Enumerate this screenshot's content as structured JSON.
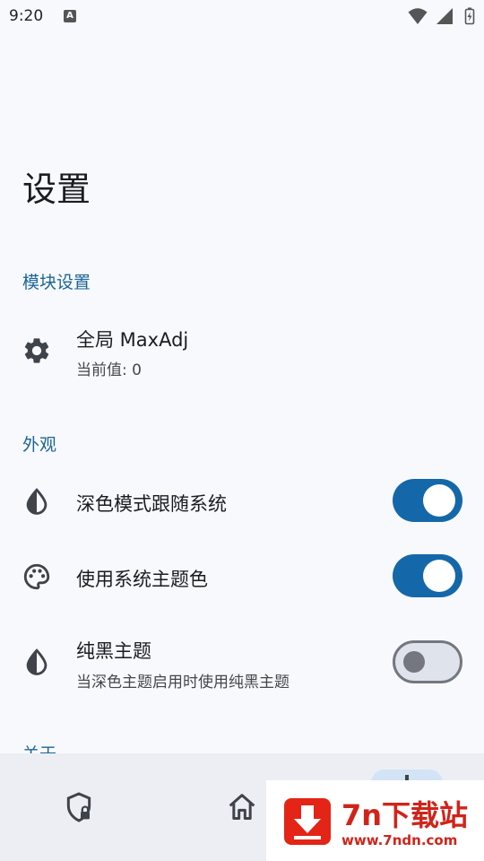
{
  "status_bar": {
    "time": "9:20",
    "notification_icon": "A"
  },
  "page_title": "设置",
  "sections": [
    {
      "header": "模块设置",
      "items": [
        {
          "icon": "gear-icon",
          "title": "全局 MaxAdj",
          "summary": "当前值: 0"
        }
      ]
    },
    {
      "header": "外观",
      "items": [
        {
          "icon": "contrast-drop-icon",
          "title": "深色模式跟随系统",
          "switch_on": true
        },
        {
          "icon": "palette-icon",
          "title": "使用系统主题色",
          "switch_on": true
        },
        {
          "icon": "contrast-drop-icon",
          "title": "纯黑主题",
          "summary": "当深色主题启用时使用纯黑主题",
          "switch_on": false
        }
      ]
    },
    {
      "header": "关于"
    }
  ],
  "bottom_nav": [
    {
      "icon": "shield-lock-icon"
    },
    {
      "icon": "home-icon"
    },
    {
      "icon": "settings-icon",
      "selected": true
    }
  ],
  "watermark": {
    "title": "7n下载站",
    "url": "www.7ndn.com"
  },
  "colors": {
    "accent": "#1468a9",
    "section_header": "#1c6596",
    "background": "#f8f9fc"
  }
}
